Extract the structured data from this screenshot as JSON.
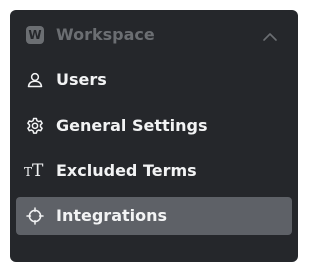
{
  "workspace": {
    "badge": "W",
    "title": "Workspace",
    "collapse_icon": "chevron-up-icon"
  },
  "nav": {
    "items": [
      {
        "label": "Users",
        "icon": "user-icon",
        "active": false
      },
      {
        "label": "General Settings",
        "icon": "gear-icon",
        "active": false
      },
      {
        "label": "Excluded Terms",
        "icon": "text-size-icon",
        "active": false
      },
      {
        "label": "Integrations",
        "icon": "crosshair-icon",
        "active": true
      }
    ]
  },
  "colors": {
    "panel_bg": "#25272b",
    "active_bg": "#5e6167",
    "muted_text": "#6b6e72",
    "text": "#f2f3f4"
  }
}
